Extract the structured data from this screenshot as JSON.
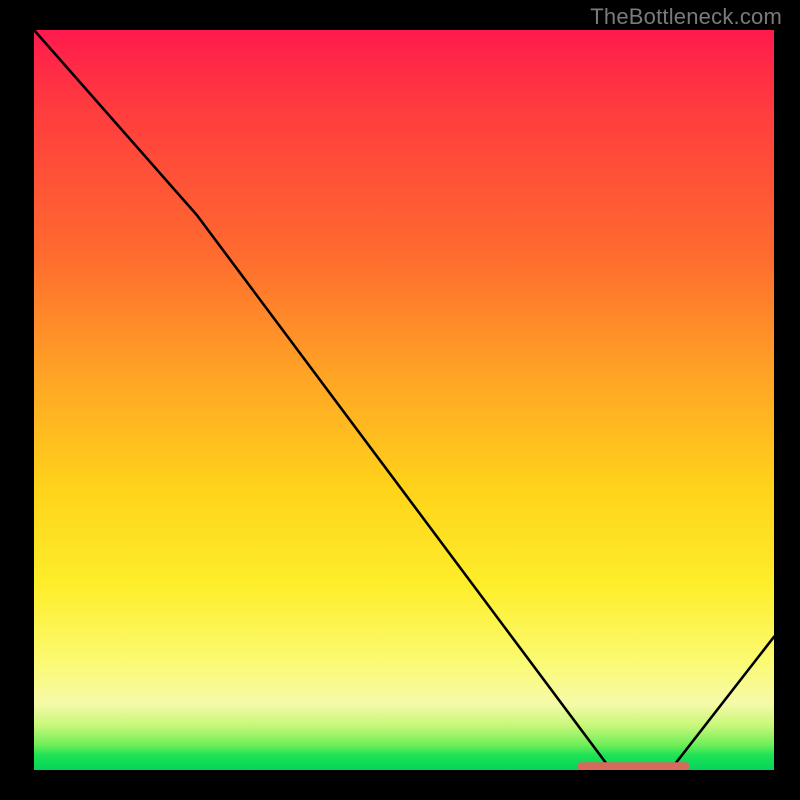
{
  "watermark": "TheBottleneck.com",
  "chart_data": {
    "type": "line",
    "title": "",
    "xlabel": "",
    "ylabel": "",
    "xlim": [
      0,
      100
    ],
    "ylim": [
      0,
      100
    ],
    "grid": false,
    "series": [
      {
        "name": "bottleneck-curve",
        "x": [
          0,
          22,
          78,
          86,
          100
        ],
        "values": [
          100,
          75,
          0,
          0,
          18
        ]
      }
    ],
    "annotations": [
      {
        "name": "optimal-marker",
        "kind": "segment",
        "x_start": 74,
        "x_end": 88,
        "y": 0.5,
        "color": "#d66a5d"
      }
    ],
    "background_gradient": {
      "direction": "vertical",
      "stops": [
        {
          "pos": 0,
          "color": "#ff1a4d"
        },
        {
          "pos": 0.3,
          "color": "#ff6a2f"
        },
        {
          "pos": 0.62,
          "color": "#ffd31a"
        },
        {
          "pos": 0.85,
          "color": "#fbfa6f"
        },
        {
          "pos": 0.96,
          "color": "#74ef5a"
        },
        {
          "pos": 1.0,
          "color": "#05d35a"
        }
      ]
    }
  }
}
